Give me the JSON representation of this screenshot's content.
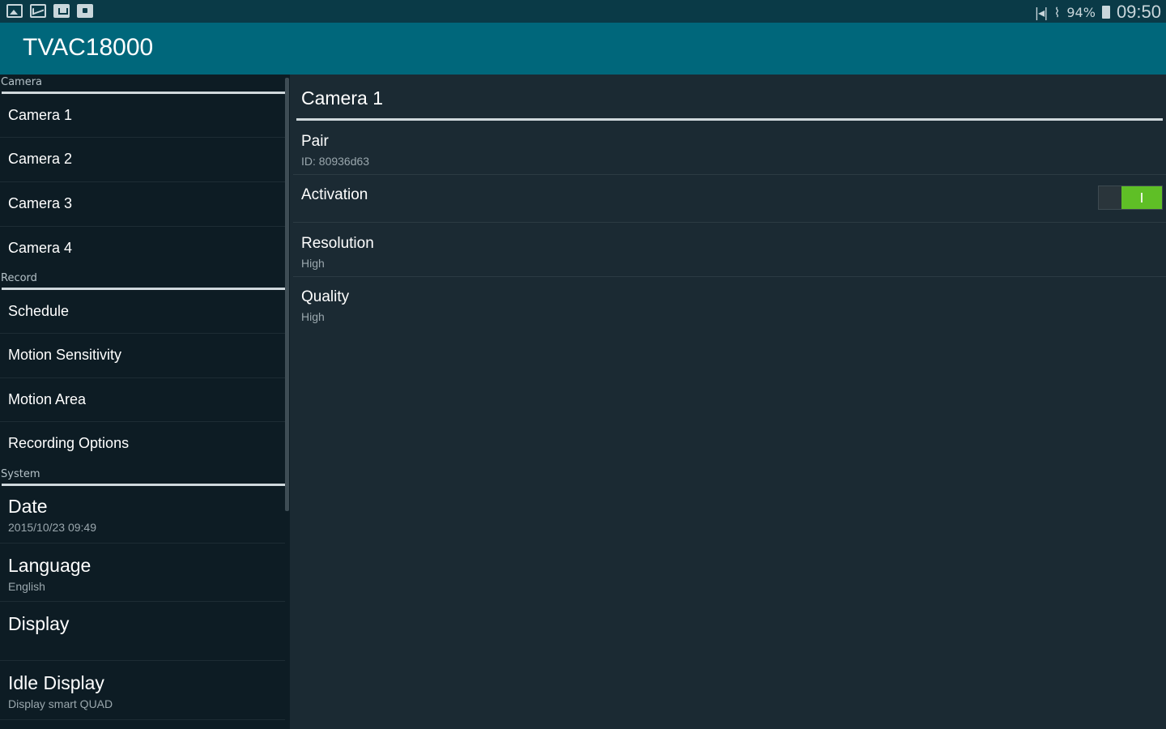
{
  "status_bar": {
    "battery_percent": "94%",
    "time": "09:50",
    "icons": [
      "gallery-icon",
      "mail-icon",
      "bag-icon",
      "store-icon",
      "mute-icon",
      "wifi-icon",
      "battery-icon"
    ]
  },
  "app_bar": {
    "title": "TVAC18000"
  },
  "sidebar": {
    "sections": [
      {
        "header": "Camera",
        "items": [
          {
            "label": "Camera 1"
          },
          {
            "label": "Camera 2"
          },
          {
            "label": "Camera 3"
          },
          {
            "label": "Camera 4"
          }
        ]
      },
      {
        "header": "Record",
        "items": [
          {
            "label": "Schedule"
          },
          {
            "label": "Motion Sensitivity"
          },
          {
            "label": "Motion Area"
          },
          {
            "label": "Recording Options"
          }
        ]
      },
      {
        "header": "System",
        "items": [
          {
            "label": "Date",
            "sub": "2015/10/23 09:49"
          },
          {
            "label": "Language",
            "sub": "English"
          },
          {
            "label": "Display"
          },
          {
            "label": "Idle Display",
            "sub": "Display smart QUAD"
          }
        ]
      }
    ]
  },
  "main": {
    "title": "Camera 1",
    "prefs": [
      {
        "title": "Pair",
        "summary": "ID: 80936d63"
      },
      {
        "title": "Activation",
        "toggle_on": true
      },
      {
        "title": "Resolution",
        "summary": "High"
      },
      {
        "title": "Quality",
        "summary": "High"
      }
    ]
  },
  "colors": {
    "status_bar": "#0a3a47",
    "app_bar": "#00677b",
    "sidebar": "#0d1c24",
    "main": "#1b2a33",
    "toggle_on": "#5fbf26"
  }
}
